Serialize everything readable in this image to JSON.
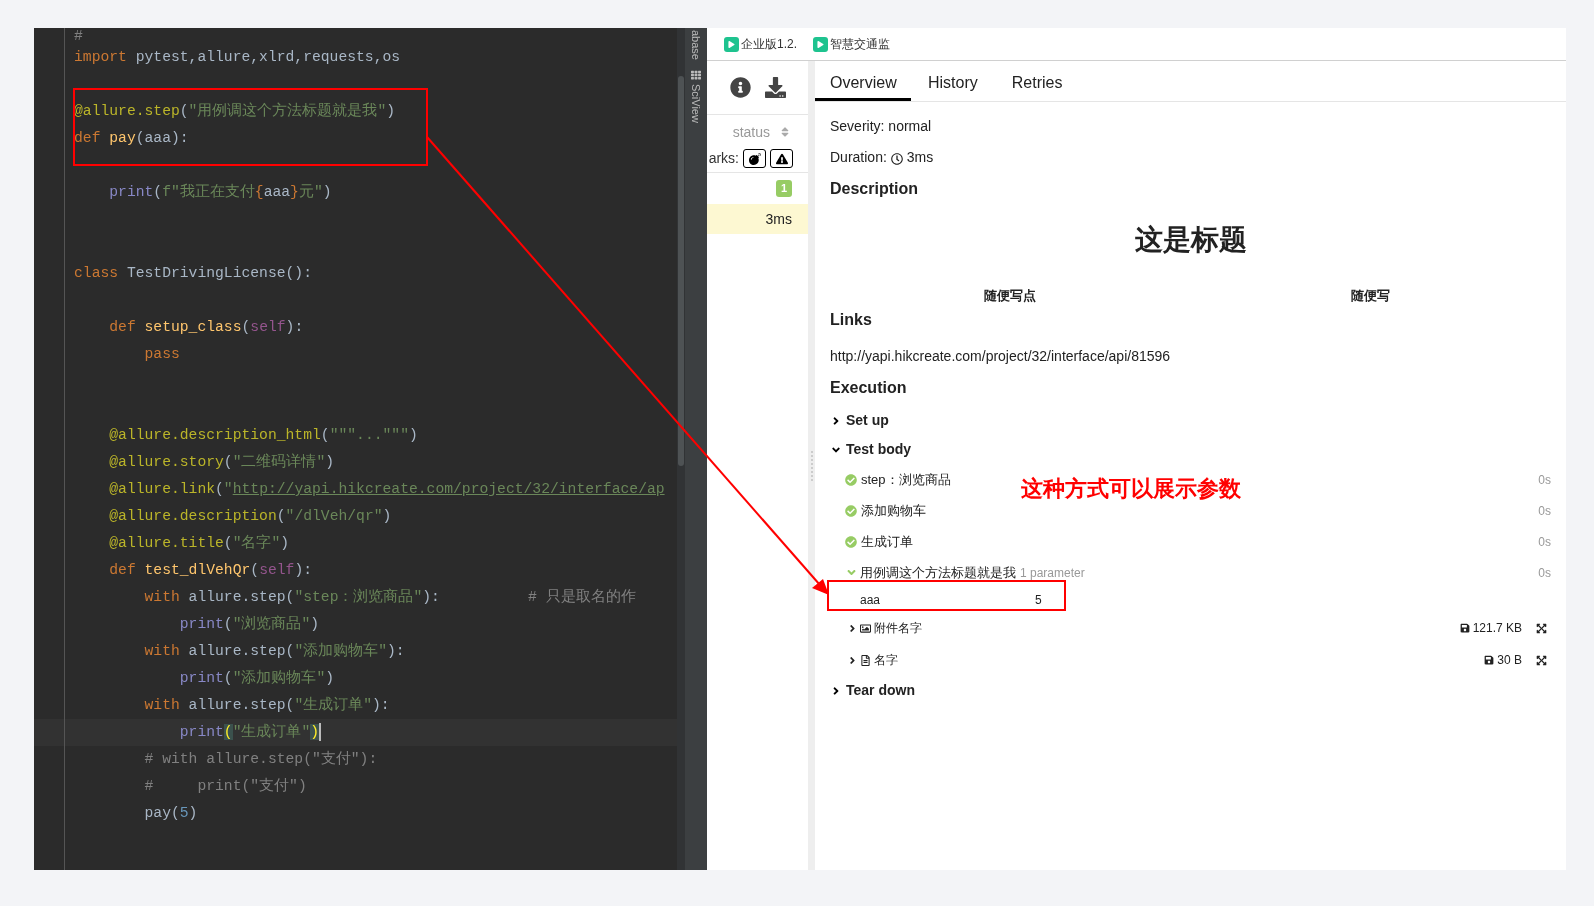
{
  "editor": {
    "lines": [
      {
        "kind": "cut",
        "current": false,
        "tokens": [
          {
            "kind": "comment",
            "text": "#"
          }
        ]
      },
      {
        "kind": "code",
        "current": false,
        "tokens": [
          {
            "kind": "keyword",
            "text": "import"
          },
          {
            "kind": "plain",
            "text": " pytest,allure,xlrd,requests,os"
          }
        ]
      },
      {
        "kind": "blank"
      },
      {
        "kind": "code",
        "current": false,
        "tokens": [
          {
            "kind": "decorator",
            "text": "@allure.step"
          },
          {
            "kind": "plain",
            "text": "("
          },
          {
            "kind": "string",
            "text": "\"用例调这个方法标题就是我\""
          },
          {
            "kind": "plain",
            "text": ")"
          }
        ]
      },
      {
        "kind": "code",
        "current": false,
        "tokens": [
          {
            "kind": "keyword",
            "text": "def"
          },
          {
            "kind": "function",
            "text": " pay"
          },
          {
            "kind": "plain",
            "text": "(aaa):"
          }
        ]
      },
      {
        "kind": "blank"
      },
      {
        "kind": "code",
        "current": false,
        "tokens": [
          {
            "kind": "builtin",
            "text": "    print"
          },
          {
            "kind": "plain",
            "text": "("
          },
          {
            "kind": "string",
            "text": "f\"我正在支付"
          },
          {
            "kind": "keyword",
            "text": "{"
          },
          {
            "kind": "plain",
            "text": "aaa"
          },
          {
            "kind": "keyword",
            "text": "}"
          },
          {
            "kind": "string",
            "text": "元\""
          },
          {
            "kind": "plain",
            "text": ")"
          }
        ]
      },
      {
        "kind": "blank"
      },
      {
        "kind": "blank"
      },
      {
        "kind": "code",
        "current": false,
        "tokens": [
          {
            "kind": "keyword",
            "text": "class"
          },
          {
            "kind": "plain",
            "text": " TestDrivingLicense():"
          }
        ]
      },
      {
        "kind": "blank"
      },
      {
        "kind": "code",
        "current": false,
        "tokens": [
          {
            "kind": "keyword",
            "text": "    def"
          },
          {
            "kind": "function",
            "text": " setup_class"
          },
          {
            "kind": "plain",
            "text": "("
          },
          {
            "kind": "self",
            "text": "self"
          },
          {
            "kind": "plain",
            "text": "):"
          }
        ]
      },
      {
        "kind": "code",
        "current": false,
        "tokens": [
          {
            "kind": "keyword",
            "text": "        pass"
          }
        ]
      },
      {
        "kind": "blank"
      },
      {
        "kind": "blank"
      },
      {
        "kind": "code",
        "current": false,
        "tokens": [
          {
            "kind": "decorator",
            "text": "    @allure.description_html"
          },
          {
            "kind": "plain",
            "text": "("
          },
          {
            "kind": "string",
            "text": "\"\"\"...\"\"\""
          },
          {
            "kind": "plain",
            "text": ")"
          }
        ]
      },
      {
        "kind": "code",
        "current": false,
        "tokens": [
          {
            "kind": "decorator",
            "text": "    @allure.story"
          },
          {
            "kind": "plain",
            "text": "("
          },
          {
            "kind": "string",
            "text": "\"二维码详情\""
          },
          {
            "kind": "plain",
            "text": ")"
          }
        ]
      },
      {
        "kind": "code",
        "current": false,
        "tokens": [
          {
            "kind": "decorator",
            "text": "    @allure.link"
          },
          {
            "kind": "plain",
            "text": "("
          },
          {
            "kind": "string",
            "text": "\""
          },
          {
            "kind": "url",
            "text": "http://yapi.hikcreate.com/project/32/interface/ap"
          }
        ]
      },
      {
        "kind": "code",
        "current": false,
        "tokens": [
          {
            "kind": "decorator",
            "text": "    @allure.description"
          },
          {
            "kind": "plain",
            "text": "("
          },
          {
            "kind": "string",
            "text": "\"/dlVeh/qr\""
          },
          {
            "kind": "plain",
            "text": ")"
          }
        ]
      },
      {
        "kind": "code",
        "current": false,
        "tokens": [
          {
            "kind": "decorator",
            "text": "    @allure.title"
          },
          {
            "kind": "plain",
            "text": "("
          },
          {
            "kind": "string",
            "text": "\"名字\""
          },
          {
            "kind": "plain",
            "text": ")"
          }
        ]
      },
      {
        "kind": "code",
        "current": false,
        "tokens": [
          {
            "kind": "keyword",
            "text": "    def"
          },
          {
            "kind": "function",
            "text": " test_dlVehQr"
          },
          {
            "kind": "plain",
            "text": "("
          },
          {
            "kind": "self",
            "text": "self"
          },
          {
            "kind": "plain",
            "text": "):"
          }
        ]
      },
      {
        "kind": "code",
        "current": false,
        "tokens": [
          {
            "kind": "keyword",
            "text": "        with"
          },
          {
            "kind": "plain",
            "text": " allure.step("
          },
          {
            "kind": "string",
            "text": "\"step：浏览商品\""
          },
          {
            "kind": "plain",
            "text": "):"
          },
          {
            "kind": "comment",
            "text": "          # 只是取名的作"
          }
        ]
      },
      {
        "kind": "code",
        "current": false,
        "tokens": [
          {
            "kind": "builtin",
            "text": "            print"
          },
          {
            "kind": "plain",
            "text": "("
          },
          {
            "kind": "string",
            "text": "\"浏览商品\""
          },
          {
            "kind": "plain",
            "text": ")"
          }
        ]
      },
      {
        "kind": "code",
        "current": false,
        "tokens": [
          {
            "kind": "keyword",
            "text": "        with"
          },
          {
            "kind": "plain",
            "text": " allure.step("
          },
          {
            "kind": "string",
            "text": "\"添加购物车\""
          },
          {
            "kind": "plain",
            "text": "):"
          }
        ]
      },
      {
        "kind": "code",
        "current": false,
        "tokens": [
          {
            "kind": "builtin",
            "text": "            print"
          },
          {
            "kind": "plain",
            "text": "("
          },
          {
            "kind": "string",
            "text": "\"添加购物车\""
          },
          {
            "kind": "plain",
            "text": ")"
          }
        ]
      },
      {
        "kind": "code",
        "current": false,
        "tokens": [
          {
            "kind": "keyword",
            "text": "        with"
          },
          {
            "kind": "plain",
            "text": " allure.step("
          },
          {
            "kind": "string",
            "text": "\"生成订单\""
          },
          {
            "kind": "plain",
            "text": "):"
          }
        ]
      },
      {
        "kind": "code",
        "current": true,
        "tokens": [
          {
            "kind": "builtin",
            "text": "            print"
          },
          {
            "kind": "brace",
            "text": "("
          },
          {
            "kind": "string",
            "text": "\"生成订单\""
          },
          {
            "kind": "brace",
            "text": ")"
          }
        ]
      },
      {
        "kind": "code",
        "current": false,
        "tokens": [
          {
            "kind": "comment",
            "text": "        # with allure.step(\"支付\"):"
          }
        ]
      },
      {
        "kind": "code",
        "current": false,
        "tokens": [
          {
            "kind": "comment",
            "text": "        #     print(\"支付\")"
          }
        ]
      },
      {
        "kind": "code",
        "current": false,
        "tokens": [
          {
            "kind": "plain",
            "text": "        pay("
          },
          {
            "kind": "number",
            "text": "5"
          },
          {
            "kind": "plain",
            "text": ")"
          }
        ]
      }
    ]
  },
  "tool_strip": [
    "abase",
    "SciView"
  ],
  "browser_tabs": [
    {
      "label": "企业版1.2."
    },
    {
      "label": "智慧交通监"
    }
  ],
  "report": {
    "sidebar": {
      "sort_label": "status",
      "marks_label": "arks:",
      "badge": "1",
      "duration": "3ms"
    },
    "tabs": [
      {
        "label": "Overview",
        "selected": true
      },
      {
        "label": "History",
        "selected": false
      },
      {
        "label": "Retries",
        "selected": false
      }
    ],
    "severity": "Severity: normal",
    "duration_label": "Duration:",
    "duration_value": "3ms",
    "description_heading": "Description",
    "description_title": "这是标题",
    "description_cells": [
      "随便写点",
      "随便写"
    ],
    "links_heading": "Links",
    "link": "http://yapi.hikcreate.com/project/32/interface/api/81596",
    "execution_heading": "Execution",
    "sections": [
      {
        "title": "Set up",
        "expanded": false
      },
      {
        "title": "Test body",
        "expanded": true,
        "steps": [
          {
            "kind": "step",
            "name": "step：浏览商品",
            "time": "0s"
          },
          {
            "kind": "step",
            "name": "添加购物车",
            "time": "0s"
          },
          {
            "kind": "step",
            "name": "生成订单",
            "time": "0s"
          },
          {
            "kind": "group",
            "name": "用例调这个方法标题就是我",
            "params_label": "1 parameter",
            "time": "0s",
            "parameters": [
              {
                "name": "aaa",
                "value": "5"
              }
            ]
          }
        ],
        "attachments": [
          {
            "kind": "image",
            "name": "附件名字",
            "size": "121.7 KB"
          },
          {
            "kind": "text",
            "name": "名字",
            "size": "30 B"
          }
        ]
      },
      {
        "title": "Tear down",
        "expanded": false
      }
    ]
  },
  "annotation": {
    "note": "这种方式可以展示参数"
  }
}
